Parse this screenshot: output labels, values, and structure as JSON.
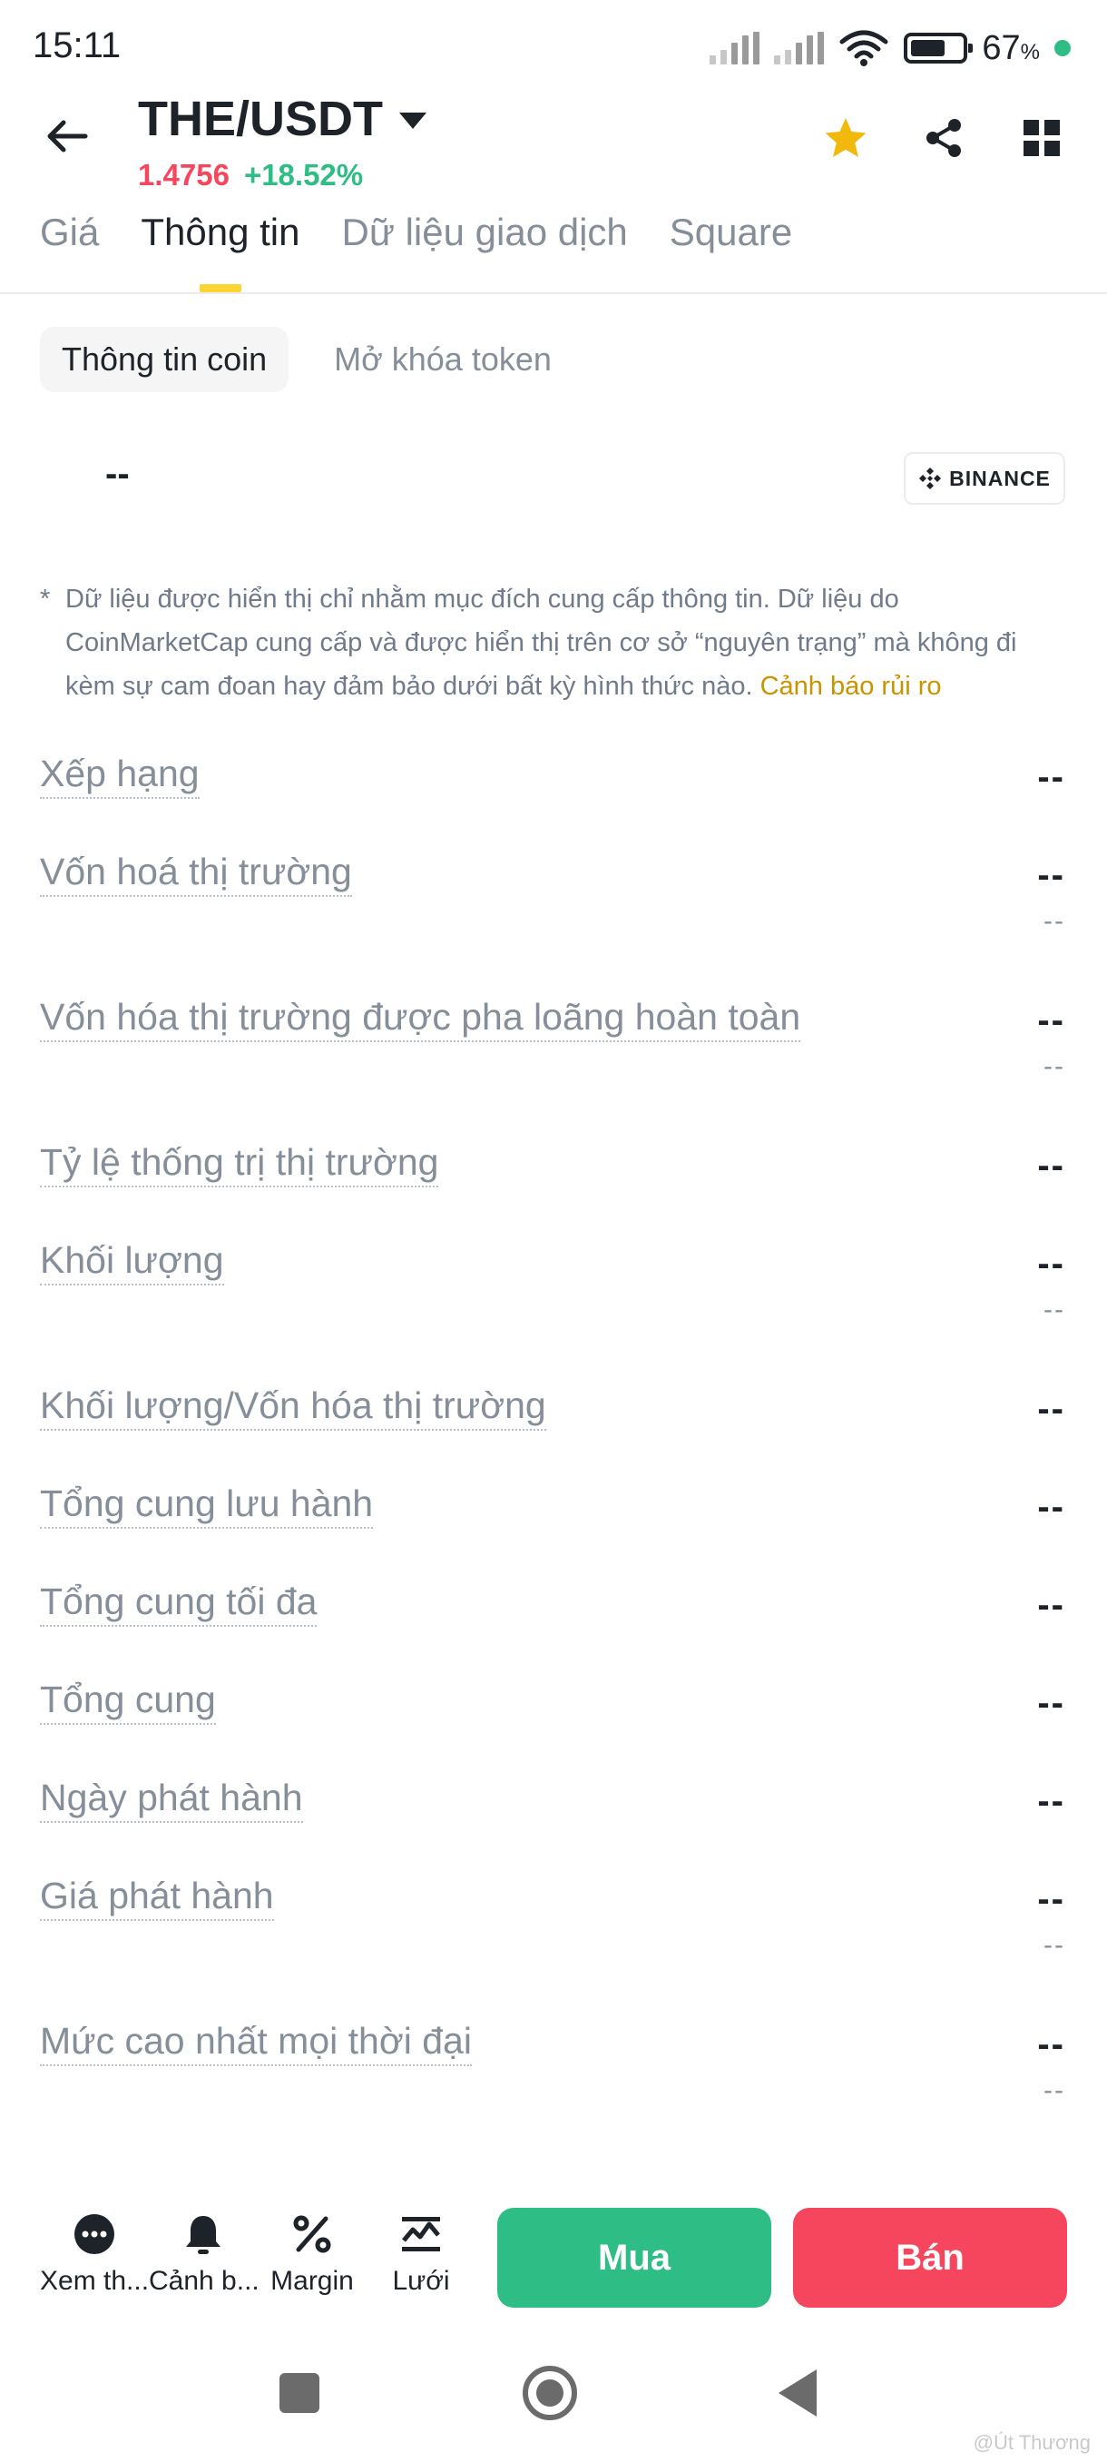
{
  "status_bar": {
    "time": "15:11",
    "battery_percent": "67",
    "battery_unit": "%",
    "battery_level": 0.67
  },
  "header": {
    "pair": "THE/USDT",
    "price": "1.4756",
    "change": "+18.52%",
    "icons": [
      "back-arrow-icon",
      "star-icon",
      "share-icon",
      "grid-icon"
    ],
    "colors": {
      "price": "#f6465d",
      "change": "#2ebd85",
      "favorite": "#f0b90b"
    }
  },
  "tabs": [
    {
      "label": "Giá"
    },
    {
      "label": "Thông tin",
      "active": true
    },
    {
      "label": "Dữ liệu giao dịch"
    },
    {
      "label": "Square"
    }
  ],
  "subtabs": [
    {
      "label": "Thông tin coin",
      "active": true
    },
    {
      "label": "Mở khóa token"
    }
  ],
  "coin": {
    "name": "--",
    "source_logo": "BINANCE"
  },
  "disclaimer": {
    "bullet": "*",
    "text": "Dữ liệu được hiển thị chỉ nhằm mục đích cung cấp thông tin. Dữ liệu do CoinMarketCap cung cấp và được hiển thị trên cơ sở “nguyên trạng” mà không đi kèm sự cam đoan hay đảm bảo dưới bất kỳ hình thức nào.",
    "link": "Cảnh báo rủi ro"
  },
  "stats": [
    {
      "label": "Xếp hạng",
      "value": "--"
    },
    {
      "label": "Vốn hoá thị trường",
      "value": "--",
      "sub": "--"
    },
    {
      "label": "Vốn hóa thị trường được pha loãng hoàn toàn",
      "value": "--",
      "sub": "--"
    },
    {
      "label": "Tỷ lệ thống trị thị trường",
      "value": "--"
    },
    {
      "label": "Khối lượng",
      "value": "--",
      "sub": "--"
    },
    {
      "label": "Khối lượng/Vốn hóa thị trường",
      "value": "--"
    },
    {
      "label": "Tổng cung lưu hành",
      "value": "--"
    },
    {
      "label": "Tổng cung tối đa",
      "value": "--"
    },
    {
      "label": "Tổng cung",
      "value": "--"
    },
    {
      "label": "Ngày phát hành",
      "value": "--"
    },
    {
      "label": "Giá phát hành",
      "value": "--",
      "sub": "--"
    },
    {
      "label": "Mức cao nhất mọi thời đại",
      "value": "--",
      "sub": "--"
    }
  ],
  "bottom_bar": {
    "items": [
      {
        "label": "Xem th...",
        "icon": "more-dots-icon"
      },
      {
        "label": "Cảnh b...",
        "icon": "bell-icon"
      },
      {
        "label": "Margin",
        "icon": "percent-icon"
      },
      {
        "label": "Lưới",
        "icon": "grid-trading-icon"
      }
    ],
    "buy_label": "Mua",
    "sell_label": "Bán"
  },
  "watermark": "@Út Thương"
}
